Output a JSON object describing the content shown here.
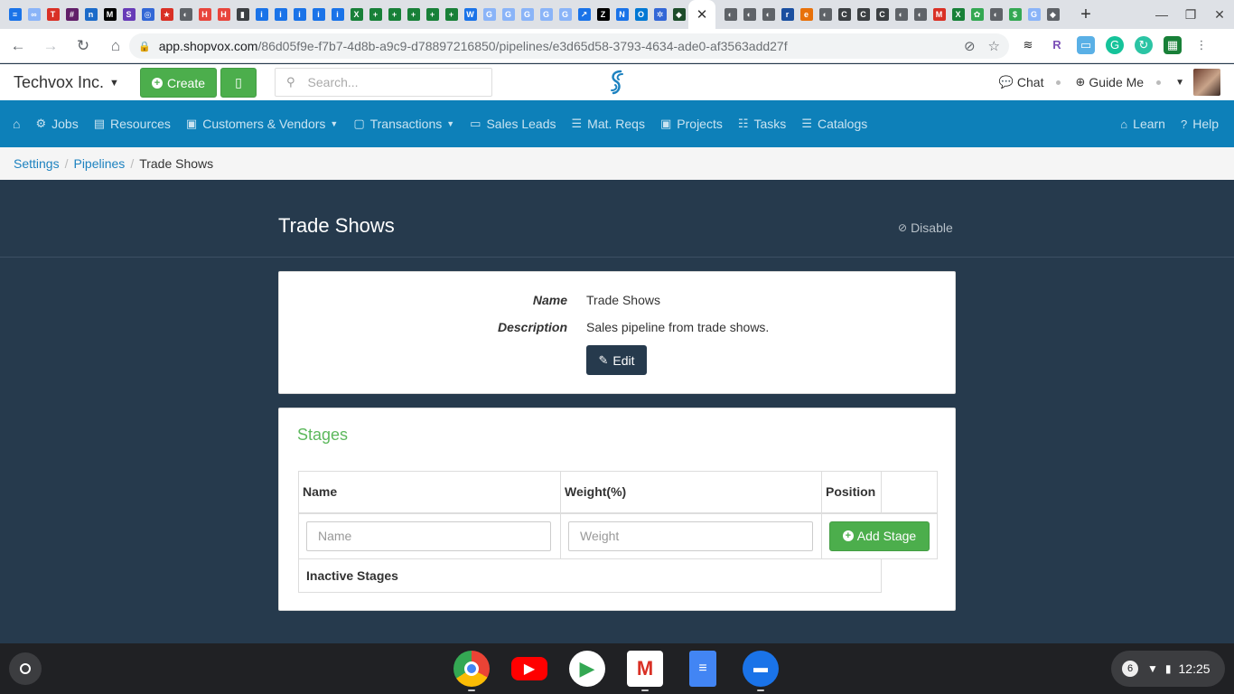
{
  "browser": {
    "url_host": "app.shopvox.com",
    "url_path": "/86d05f9e-f7b7-4d8b-a9c9-d78897216850/pipelines/e3d65d58-3793-4634-ade0-af3563add27f",
    "tab_close_glyph": "✕",
    "new_tab_glyph": "+",
    "favicons": [
      {
        "glyph": "≡",
        "color": "#1a73e8"
      },
      {
        "glyph": "∞",
        "color": "#8ab4f8"
      },
      {
        "glyph": "T",
        "color": "#d93025"
      },
      {
        "glyph": "#",
        "color": "#611f69"
      },
      {
        "glyph": "n",
        "color": "#1b6ac9"
      },
      {
        "glyph": "M",
        "color": "#000000"
      },
      {
        "glyph": "S",
        "color": "#673ab7"
      },
      {
        "glyph": "◎",
        "color": "#3367d6"
      },
      {
        "glyph": "★",
        "color": "#d93025"
      },
      {
        "glyph": "◐",
        "color": "#5f6368"
      },
      {
        "glyph": "H",
        "color": "#e8453c"
      },
      {
        "glyph": "H",
        "color": "#e8453c"
      },
      {
        "glyph": "▮",
        "color": "#3c4043"
      },
      {
        "glyph": "i",
        "color": "#1a73e8"
      },
      {
        "glyph": "i",
        "color": "#1a73e8"
      },
      {
        "glyph": "i",
        "color": "#1a73e8"
      },
      {
        "glyph": "i",
        "color": "#1a73e8"
      },
      {
        "glyph": "i",
        "color": "#1a73e8"
      },
      {
        "glyph": "X",
        "color": "#188038"
      },
      {
        "glyph": "+",
        "color": "#188038"
      },
      {
        "glyph": "+",
        "color": "#188038"
      },
      {
        "glyph": "+",
        "color": "#188038"
      },
      {
        "glyph": "+",
        "color": "#188038"
      },
      {
        "glyph": "+",
        "color": "#188038"
      },
      {
        "glyph": "W",
        "color": "#1a73e8"
      },
      {
        "glyph": "G",
        "color": "#8ab4f8"
      },
      {
        "glyph": "G",
        "color": "#8ab4f8"
      },
      {
        "glyph": "G",
        "color": "#8ab4f8"
      },
      {
        "glyph": "G",
        "color": "#8ab4f8"
      },
      {
        "glyph": "G",
        "color": "#8ab4f8"
      },
      {
        "glyph": "↗",
        "color": "#1a73e8"
      },
      {
        "glyph": "Z",
        "color": "#000000"
      },
      {
        "glyph": "N",
        "color": "#1a73e8"
      },
      {
        "glyph": "O",
        "color": "#0078d4"
      },
      {
        "glyph": "✲",
        "color": "#3367d6"
      },
      {
        "glyph": "◆",
        "color": "#1e4d2b"
      }
    ],
    "favicons_after": [
      {
        "glyph": "◐",
        "color": "#5f6368"
      },
      {
        "glyph": "◐",
        "color": "#5f6368"
      },
      {
        "glyph": "◐",
        "color": "#5f6368"
      },
      {
        "glyph": "r",
        "color": "#1a4fa0"
      },
      {
        "glyph": "e",
        "color": "#e8710a"
      },
      {
        "glyph": "◐",
        "color": "#5f6368"
      },
      {
        "glyph": "C",
        "color": "#3c4043"
      },
      {
        "glyph": "C",
        "color": "#3c4043"
      },
      {
        "glyph": "C",
        "color": "#3c4043"
      },
      {
        "glyph": "◐",
        "color": "#5f6368"
      },
      {
        "glyph": "◐",
        "color": "#5f6368"
      },
      {
        "glyph": "M",
        "color": "#d93025"
      },
      {
        "glyph": "X",
        "color": "#188038"
      },
      {
        "glyph": "✿",
        "color": "#34a853"
      },
      {
        "glyph": "◐",
        "color": "#5f6368"
      },
      {
        "glyph": "$",
        "color": "#34a853"
      },
      {
        "glyph": "G",
        "color": "#8ab4f8"
      },
      {
        "glyph": "◆",
        "color": "#5f6368"
      }
    ]
  },
  "header": {
    "company": "Techvox Inc.",
    "create_label": "Create",
    "search_placeholder": "Search...",
    "chat_label": "Chat",
    "guide_label": "Guide Me"
  },
  "nav": {
    "items": [
      {
        "label": "Jobs"
      },
      {
        "label": "Resources"
      },
      {
        "label": "Customers & Vendors"
      },
      {
        "label": "Transactions"
      },
      {
        "label": "Sales Leads"
      },
      {
        "label": "Mat. Reqs"
      },
      {
        "label": "Projects"
      },
      {
        "label": "Tasks"
      },
      {
        "label": "Catalogs"
      }
    ],
    "learn_label": "Learn",
    "help_label": "Help"
  },
  "breadcrumb": {
    "items": [
      "Settings",
      "Pipelines"
    ],
    "current": "Trade Shows"
  },
  "page": {
    "title": "Trade Shows",
    "disable_label": "Disable"
  },
  "details": {
    "name_label": "Name",
    "name_value": "Trade Shows",
    "description_label": "Description",
    "description_value": "Sales pipeline from trade shows.",
    "edit_label": "Edit"
  },
  "stages": {
    "title": "Stages",
    "columns": [
      "Name",
      "Weight(%)",
      "Position"
    ],
    "name_placeholder": "Name",
    "weight_placeholder": "Weight",
    "add_label": "Add Stage",
    "inactive_label": "Inactive Stages"
  },
  "shelf": {
    "notification_count": "6",
    "time": "12:25"
  },
  "colors": {
    "nav_bg": "#0d80b9",
    "page_bg": "#263a4d",
    "success": "#4cae4c",
    "link": "#1d82c0"
  }
}
